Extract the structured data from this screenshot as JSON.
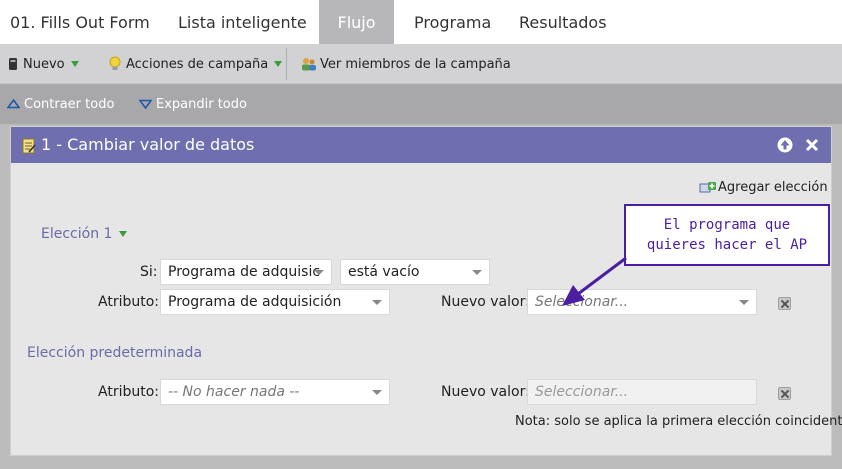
{
  "tabs": [
    {
      "label": "01. Fills Out Form"
    },
    {
      "label": "Lista inteligente"
    },
    {
      "label": "Flujo"
    },
    {
      "label": "Programa"
    },
    {
      "label": "Resultados"
    }
  ],
  "active_tab": "Flujo",
  "toolbar": {
    "new_label": "Nuevo",
    "campaign_actions_label": "Acciones de campaña",
    "view_members_label": "Ver miembros de la campaña"
  },
  "subbar": {
    "collapse_label": "Contraer todo",
    "expand_label": "Expandir todo"
  },
  "panel": {
    "title": "1 - Cambiar valor de datos",
    "add_choice_label": "Agregar elección",
    "choice1": {
      "title": "Elección 1",
      "if_label": "Si:",
      "if_field": "Programa de adquisic",
      "if_operator": "está vacío",
      "attribute_label": "Atributo:",
      "attribute_value": "Programa de adquisición",
      "new_value_label": "Nuevo valor:",
      "new_value_placeholder": "Seleccionar..."
    },
    "default_choice": {
      "title": "Elección predeterminada",
      "attribute_label": "Atributo:",
      "attribute_value": "-- No hacer nada --",
      "new_value_label": "Nuevo valor:",
      "new_value_placeholder": "Seleccionar..."
    },
    "note": "Nota: solo se aplica la primera elección coincidente"
  },
  "callout": {
    "line1": "El programa que",
    "line2": "quieres hacer el AP"
  },
  "colors": {
    "panel_header": "#6f6faf",
    "section_title": "#6a6aa8",
    "callout": "#4b1fa0",
    "caret": "#3c9b3c"
  }
}
